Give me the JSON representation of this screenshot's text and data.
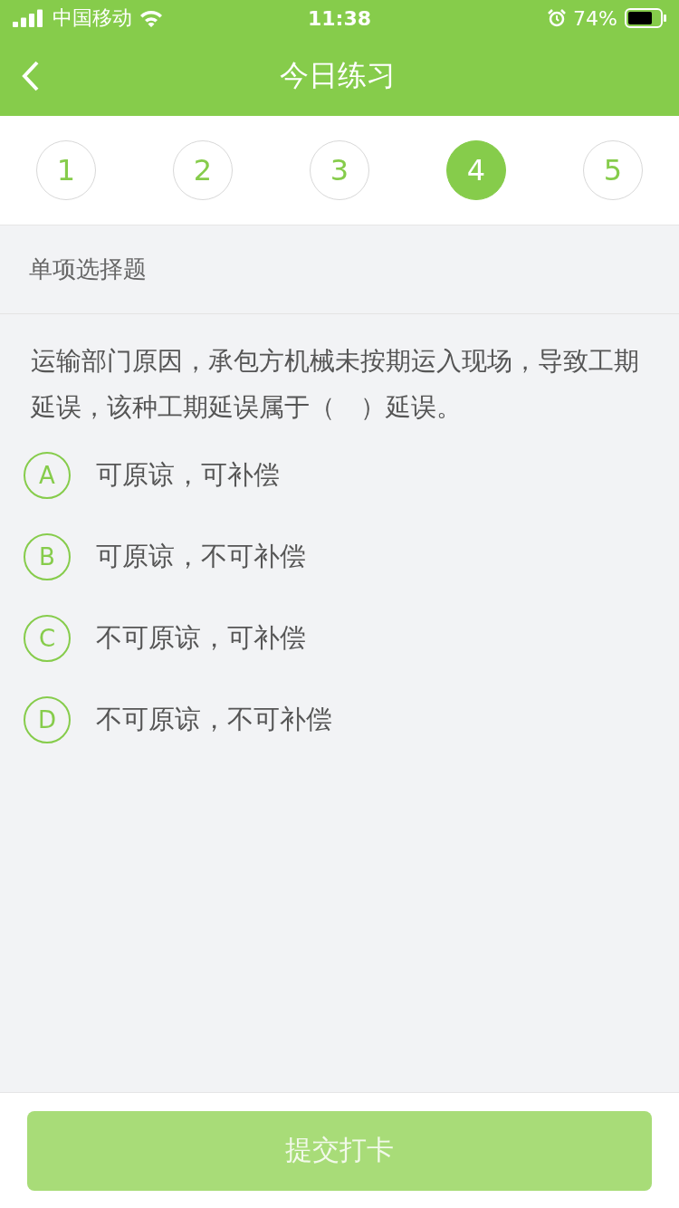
{
  "status_bar": {
    "carrier": "中国移动",
    "time": "11:38",
    "battery": "74%"
  },
  "nav": {
    "title": "今日练习"
  },
  "question_numbers": [
    {
      "label": "1",
      "selected": false
    },
    {
      "label": "2",
      "selected": false
    },
    {
      "label": "3",
      "selected": false
    },
    {
      "label": "4",
      "selected": true
    },
    {
      "label": "5",
      "selected": false
    }
  ],
  "section_title": "单项选择题",
  "question": "运输部门原因，承包方机械未按期运入现场，导致工期延误，该种工期延误属于（　）延误。",
  "options": [
    {
      "letter": "A",
      "text": "可原谅，可补偿",
      "selected": false
    },
    {
      "letter": "B",
      "text": "可原谅，不可补偿",
      "selected": false
    },
    {
      "letter": "C",
      "text": "不可原谅，可补偿",
      "selected": false
    },
    {
      "letter": "D",
      "text": "不可原谅，不可补偿",
      "selected": false
    }
  ],
  "submit": {
    "label": "提交打卡",
    "disabled": true
  }
}
